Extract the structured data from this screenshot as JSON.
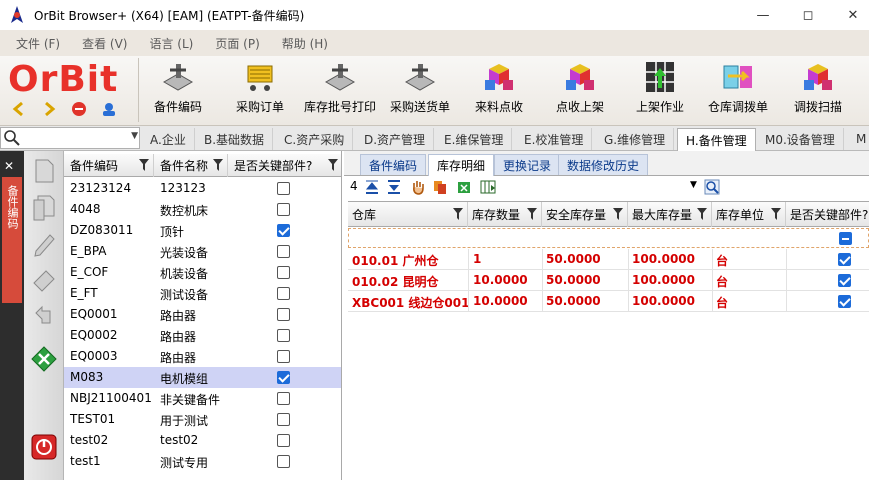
{
  "window": {
    "title": "OrBit Browser+ (X64) [EAM] (EATPT-备件编码)"
  },
  "menu": {
    "items": [
      "文件 (F)",
      "查看 (V)",
      "语言 (L)",
      "页面 (P)",
      "帮助 (H)"
    ]
  },
  "logo": {
    "text": "OrBit"
  },
  "toolbar": {
    "items": [
      "备件编码",
      "采购订单",
      "库存批号打印",
      "采购送货单",
      "来料点收",
      "点收上架",
      "上架作业",
      "仓库调拨单",
      "调拨扫描"
    ]
  },
  "modules": {
    "search_value": "",
    "tabs": [
      "A.企业",
      "B.基础数据",
      "C.资产采购",
      "D.资产管理",
      "E.维保管理",
      "E.校准管理",
      "G.维修管理",
      "H.备件管理",
      "M0.设备管理",
      "M"
    ],
    "active_index": 7
  },
  "sidebar": {
    "vertical_tab_label": "备件编码"
  },
  "left_grid": {
    "headers": [
      "备件编码",
      "备件名称",
      "是否关键部件?"
    ],
    "rows": [
      {
        "code": "23123124",
        "name": "123123",
        "key": false
      },
      {
        "code": "4048",
        "name": "数控机床",
        "key": false
      },
      {
        "code": "DZ083011",
        "name": "顶针",
        "key": true
      },
      {
        "code": "E_BPA",
        "name": "光装设备",
        "key": false
      },
      {
        "code": "E_COF",
        "name": "机装设备",
        "key": false
      },
      {
        "code": "E_FT",
        "name": "测试设备",
        "key": false
      },
      {
        "code": "EQ0001",
        "name": "路由器",
        "key": false
      },
      {
        "code": "EQ0002",
        "name": "路由器",
        "key": false
      },
      {
        "code": "EQ0003",
        "name": "路由器",
        "key": false
      },
      {
        "code": "M083",
        "name": "电机模组",
        "key": true,
        "selected": true
      },
      {
        "code": "NBJ21100401",
        "name": "非关键备件",
        "key": false
      },
      {
        "code": "TEST01",
        "name": "用于测试",
        "key": false
      },
      {
        "code": "test02",
        "name": "test02",
        "key": false
      },
      {
        "code": "test1",
        "name": "测试专用",
        "key": false
      }
    ]
  },
  "detail": {
    "subtabs": [
      "备件编码",
      "库存明细",
      "更换记录",
      "数据修改历史"
    ],
    "active_subtab": 1,
    "record_count": "4",
    "headers": [
      "仓库",
      "库存数量",
      "安全库存量",
      "最大库存量",
      "库存单位",
      "是否关键部件?"
    ],
    "rows": [
      {
        "warehouse": "010.01 广州仓",
        "qty": "1",
        "safety": "50.0000",
        "max": "100.0000",
        "unit": "台",
        "key": true
      },
      {
        "warehouse": "010.02 昆明仓",
        "qty": "10.0000",
        "safety": "50.0000",
        "max": "100.0000",
        "unit": "台",
        "key": true
      },
      {
        "warehouse": "XBC001 线边仓001",
        "qty": "10.0000",
        "safety": "50.0000",
        "max": "100.0000",
        "unit": "台",
        "key": true
      }
    ]
  },
  "colors": {
    "accent_red": "#d40000",
    "selected_row": "#cfd3f5",
    "check_blue": "#1c6bd9",
    "sidebar_tab": "#d64b3b"
  }
}
